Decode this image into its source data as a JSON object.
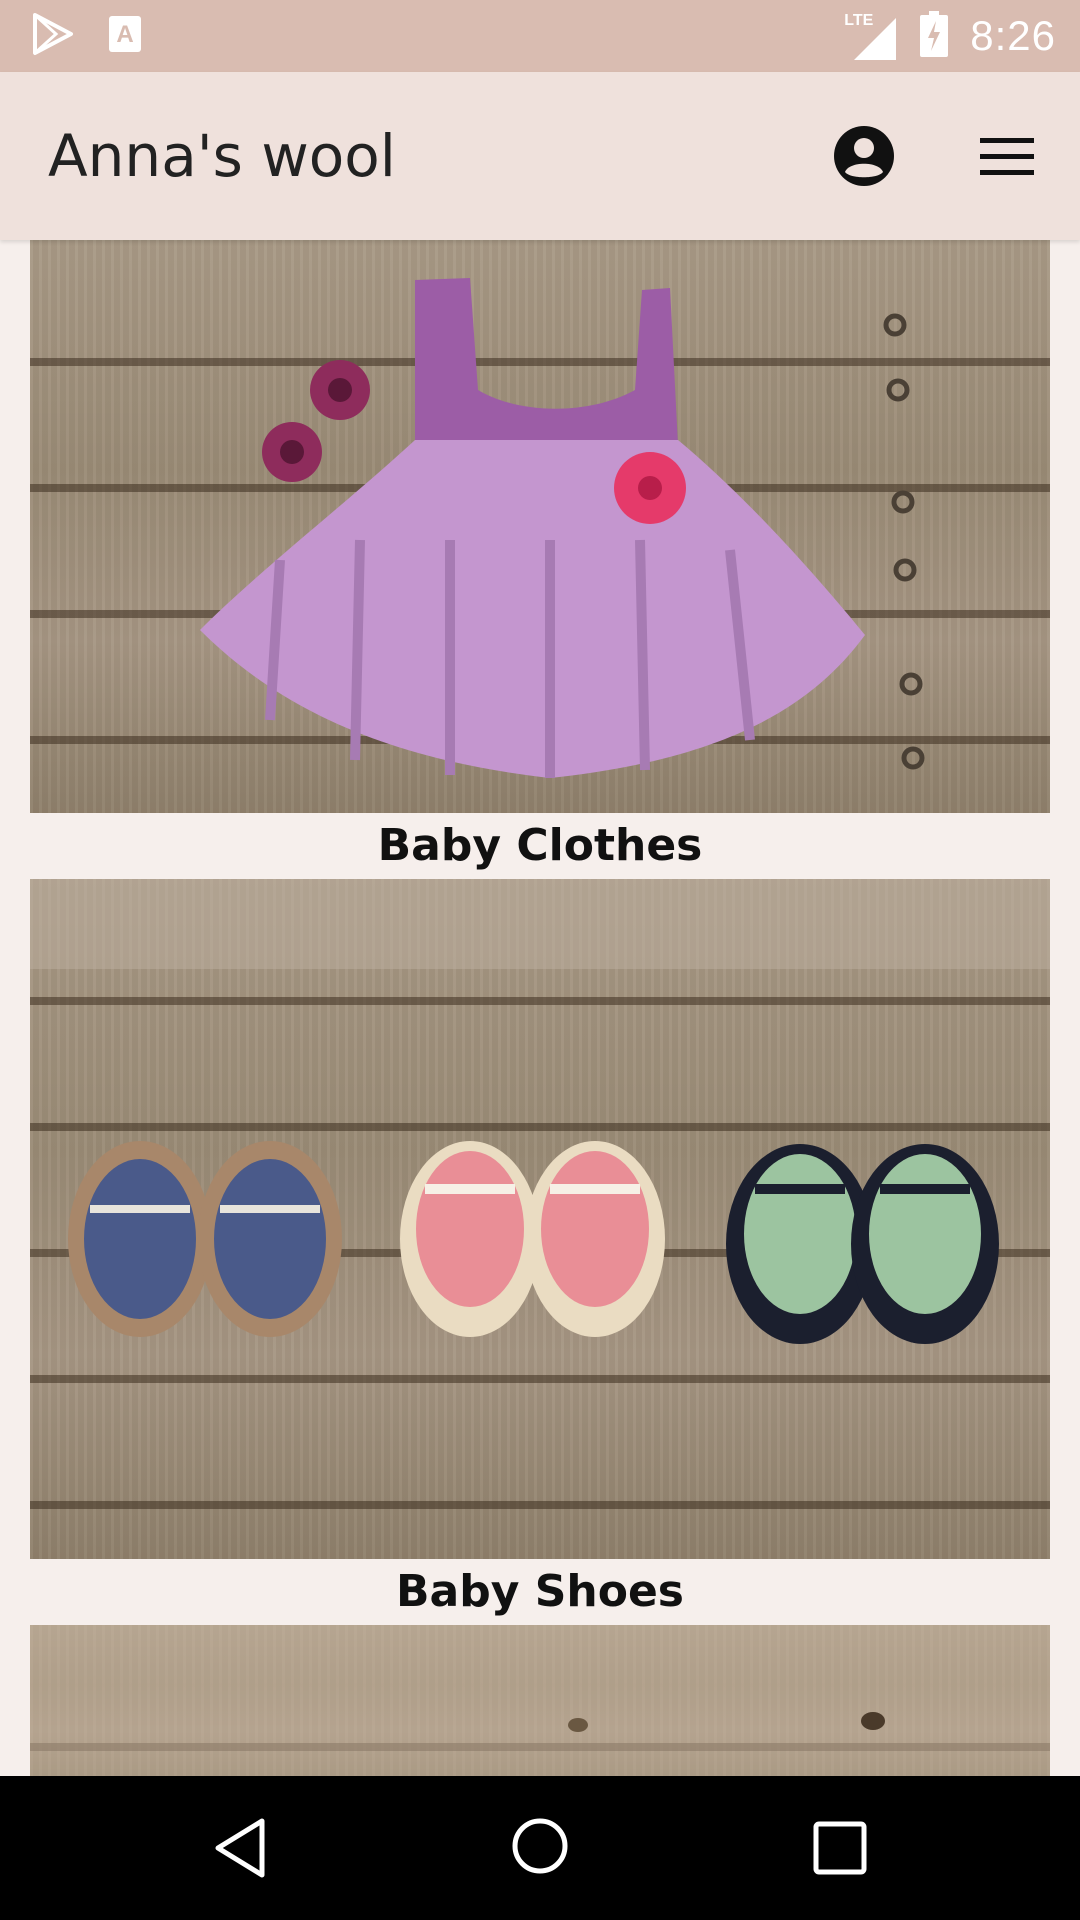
{
  "status_bar": {
    "time": "8:26",
    "network_label": "LTE",
    "icons": [
      "play-store-icon",
      "font-a-icon",
      "signal-icon",
      "battery-charging-icon"
    ]
  },
  "app_bar": {
    "title": "Anna's wool",
    "icons": [
      "account-circle-icon",
      "hamburger-menu-icon"
    ]
  },
  "categories": [
    {
      "label": "Baby Clothes",
      "image": "crocheted purple baby dress on wooden floor"
    },
    {
      "label": "Baby Shoes",
      "image": "three pairs of crocheted baby shoes on wooden floor"
    },
    {
      "label": "",
      "image": "wooden floor (partially visible)"
    }
  ],
  "colors": {
    "status_bar": "#d9bcb1",
    "app_bar": "#efe1dc",
    "background": "#f6efec",
    "nav_bar": "#000000"
  },
  "nav_bar": {
    "icons": [
      "back-triangle-icon",
      "home-circle-icon",
      "recents-square-icon"
    ]
  }
}
